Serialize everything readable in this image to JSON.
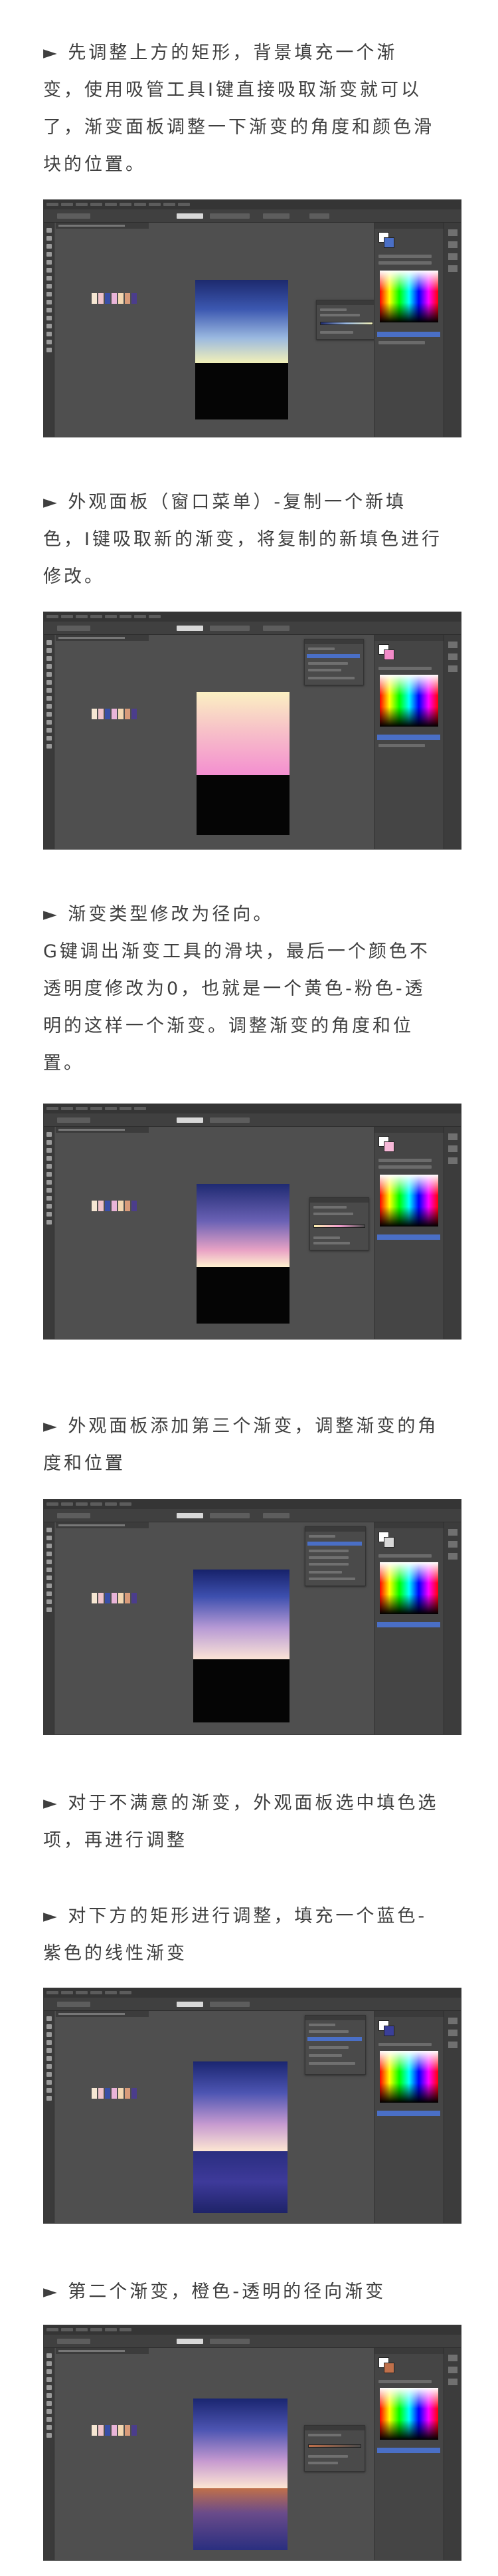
{
  "paragraphs": [
    {
      "lines": [
        "►   先调整上方的矩形，背景填充一个渐",
        "变，使用吸管工具I键直接吸取渐变就可以",
        "了，渐变面板调整一下渐变的角度和颜色滑",
        "块的位置。"
      ]
    },
    {
      "lines": [
        "► 外观面板（窗口菜单）-复制一个新填",
        "色，I键吸取新的渐变，将复制的新填色进行",
        "修改。"
      ]
    },
    {
      "lines": [
        "► 渐变类型修改为径向。",
        "G键调出渐变工具的滑块，最后一个颜色不",
        "透明度修改为0，也就是一个黄色-粉色-透",
        "明的这样一个渐变。调整渐变的角度和位",
        "置。"
      ]
    },
    {
      "lines": [
        "► 外观面板添加第三个渐变，调整渐变的角",
        "度和位置"
      ]
    },
    {
      "lines": [
        "► 对于不满意的渐变，外观面板选中填色选",
        "项，再进行调整"
      ]
    },
    {
      "lines": [
        "► 对下方的矩形进行调整，填充一个蓝色-",
        "紫色的线性渐变"
      ]
    },
    {
      "lines": [
        "► 第二个渐变，橙色-透明的径向渐变"
      ]
    }
  ],
  "screenshots": [
    {
      "artboard_top": "linear-gradient(to bottom,#1d2a6e 0%,#3b57b0 35%,#9bb9e0 70%,#f2f0b8 100%)",
      "artboard_bottom": "#050505"
    },
    {
      "artboard_top": "linear-gradient(to bottom,#fbf0c2 0%,#f7c2c8 45%,#f48fd0 100%)",
      "artboard_bottom": "#050505"
    },
    {
      "artboard_top": "linear-gradient(to bottom,#1f2a72 0%,#6b62b5 45%,#e9a3c5 80%,#fff2d0 100%)",
      "artboard_bottom": "#050505"
    },
    {
      "artboard_top": "linear-gradient(to bottom,#17226a 0%,#3d4fae 30%,#b79ad5 65%,#fbe3d6 100%)",
      "artboard_bottom": "#050505"
    },
    {
      "artboard_top": "linear-gradient(to bottom,#1a2570 0%,#4d55b2 35%,#c69ad0 70%,#fde6d3 100%)",
      "artboard_bottom": "linear-gradient(to bottom,#2a2e80 0%,#3e3a9a 50%,#1e2368 100%)"
    },
    {
      "artboard_top": "linear-gradient(to bottom,#1a2570 0%,#4d55b2 35%,#c69ad0 70%,#fde6d3 100%)",
      "artboard_bottom": "linear-gradient(to bottom,#c0704a 0%,#6a4b8a 40%,#2a2f80 100%)"
    }
  ],
  "colors": {
    "page_bg": "#ffffff",
    "text": "#3f3f3f",
    "ai_bg": "#4f4f4f",
    "ai_panel": "#454545",
    "ai_dark": "#3a3a3a",
    "ai_selection": "#4a6fc6"
  },
  "icons": [
    "triangle-bullet-icon"
  ]
}
